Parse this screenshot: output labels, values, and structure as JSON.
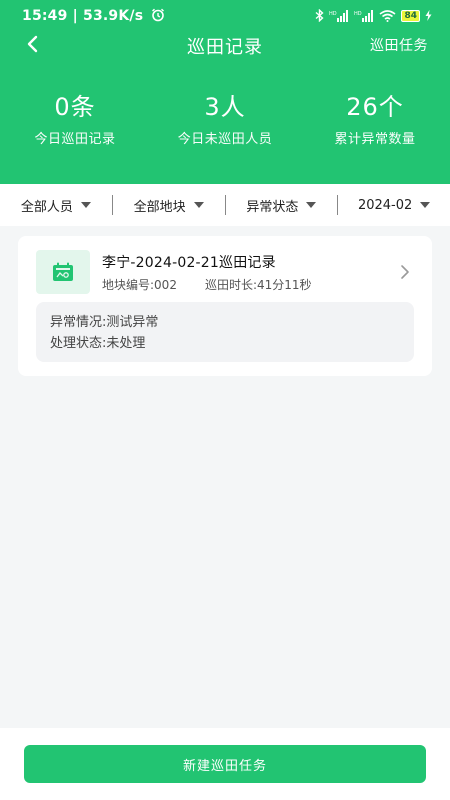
{
  "status_bar": {
    "time": "15:49 | 53.9K/s",
    "battery": "84",
    "icons": [
      "alarm-icon",
      "bluetooth-icon",
      "hd-signal-icon",
      "hd-signal-icon",
      "wifi-icon",
      "battery-icon",
      "charging-icon"
    ]
  },
  "nav": {
    "title": "巡田记录",
    "action": "巡田任务",
    "back_icon": "chevron-left-icon"
  },
  "stats": [
    {
      "value": "0条",
      "label": "今日巡田记录"
    },
    {
      "value": "3人",
      "label": "今日未巡田人员"
    },
    {
      "value": "26个",
      "label": "累计异常数量"
    }
  ],
  "filters": [
    {
      "label": "全部人员"
    },
    {
      "label": "全部地块"
    },
    {
      "label": "异常状态"
    },
    {
      "label": "2024-02"
    }
  ],
  "records": [
    {
      "title": "李宁-2024-02-21巡田记录",
      "plot_no": "地块编号:002",
      "duration": "巡田时长:41分11秒",
      "abnormal": "异常情况:测试异常",
      "status": "处理状态:未处理"
    }
  ],
  "footer": {
    "button_label": "新建巡田任务"
  },
  "colors": {
    "primary": "#22c472",
    "background": "#f4f6f7",
    "card": "#ffffff",
    "detail_bg": "#f2f3f5"
  }
}
